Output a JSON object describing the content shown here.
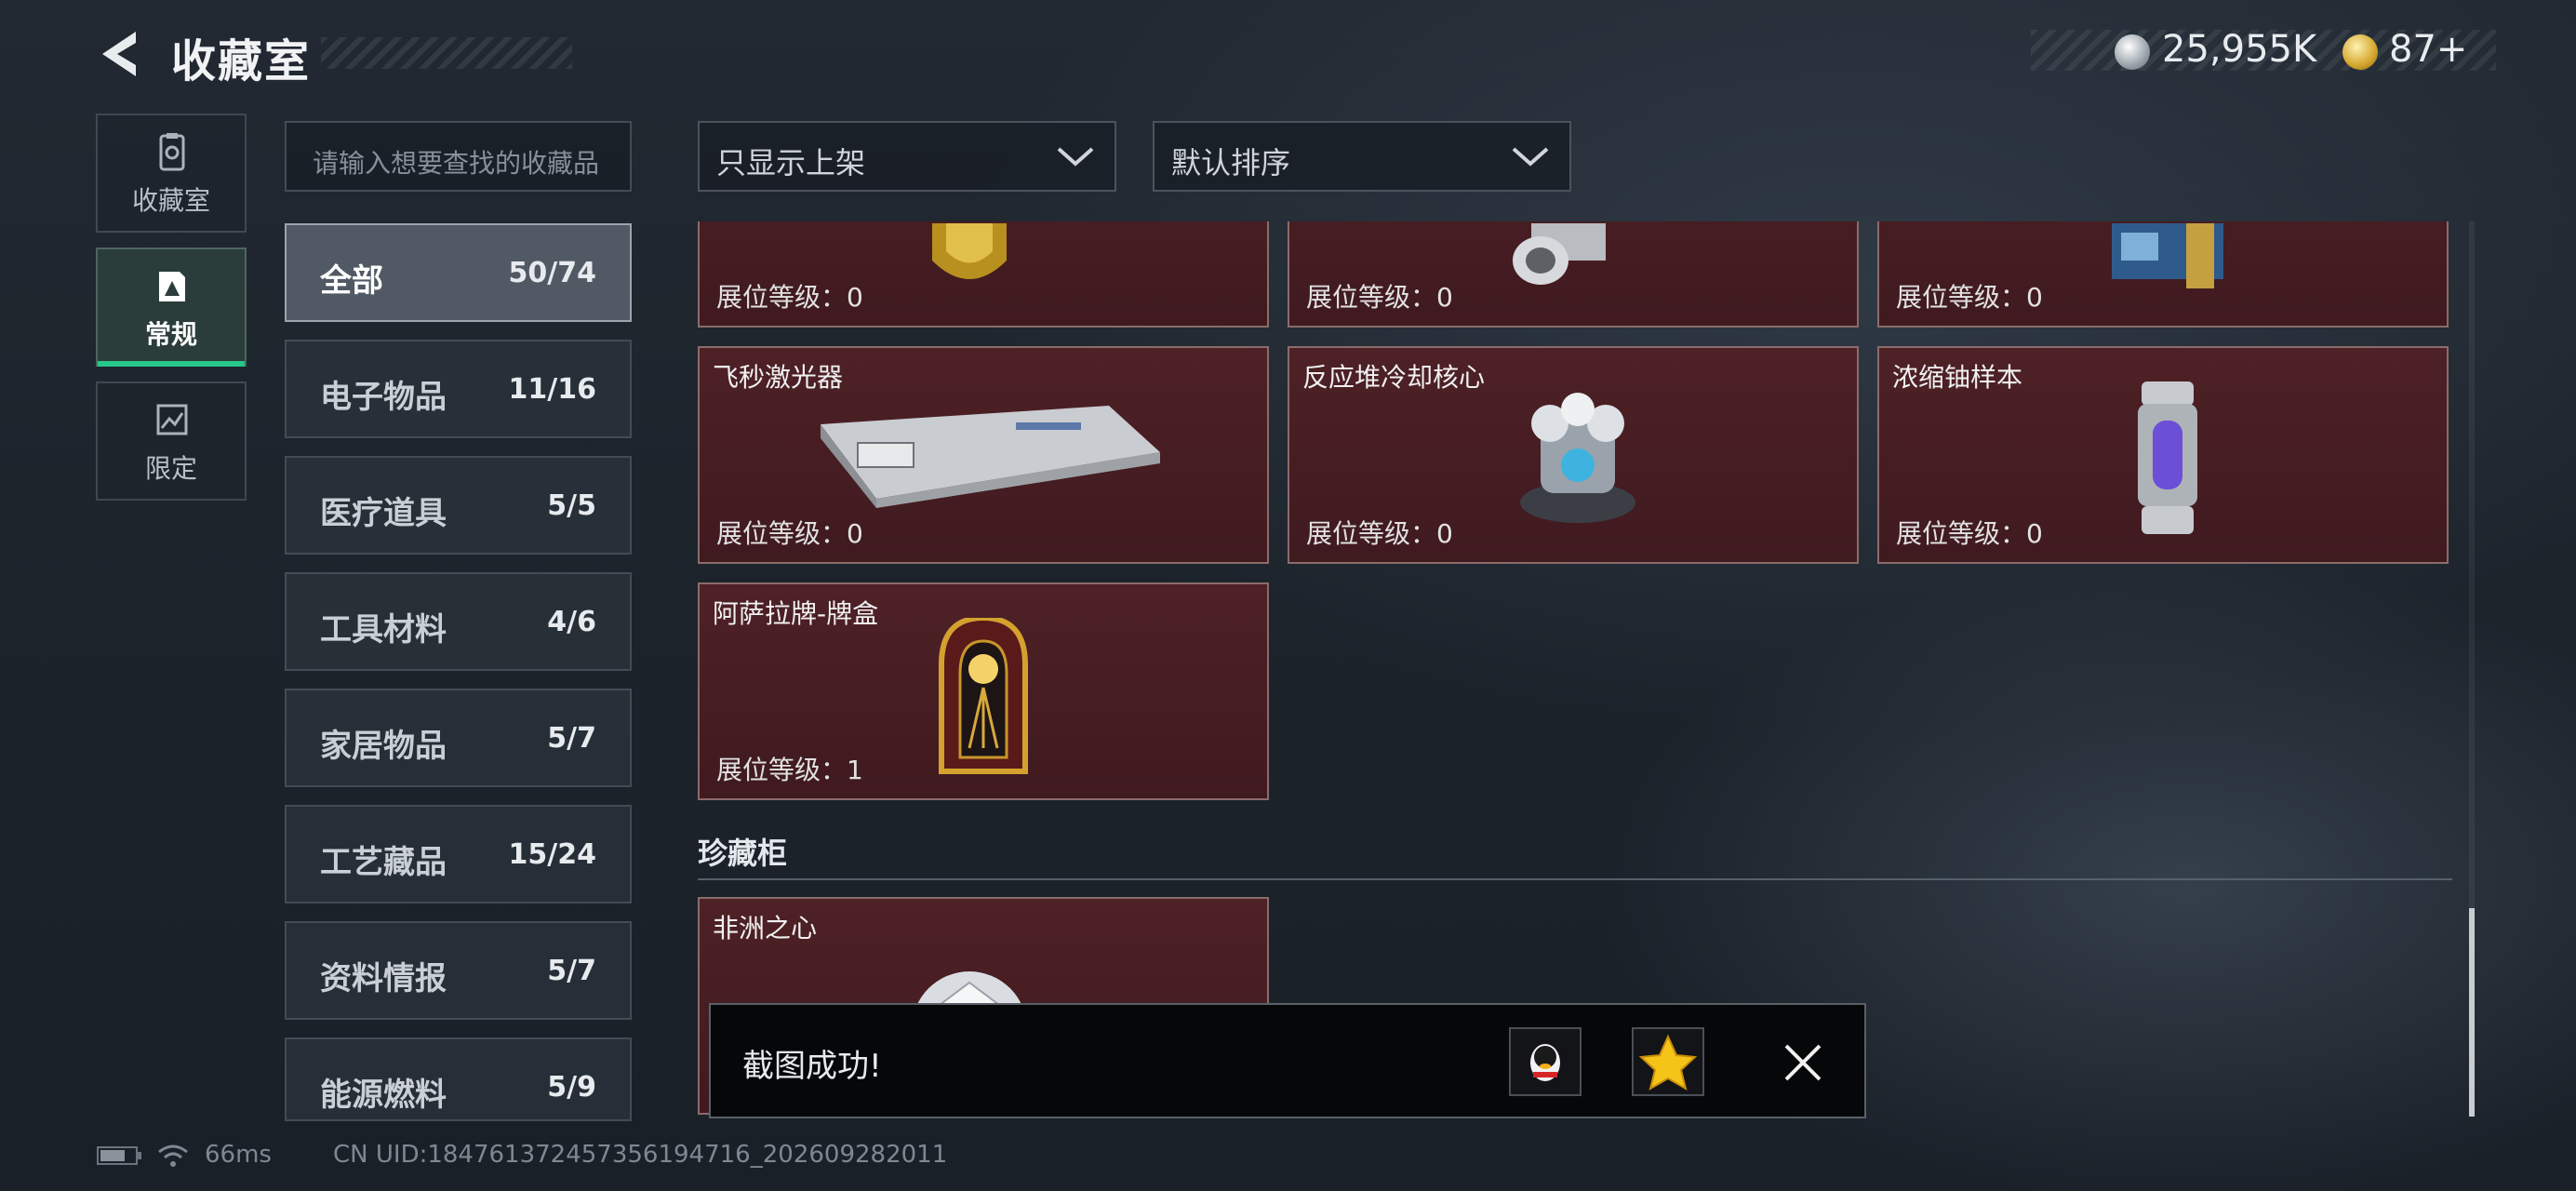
{
  "header": {
    "title": "收藏室"
  },
  "currency": {
    "silver": "25,955K",
    "gold": "87+"
  },
  "left_nav": [
    {
      "label": "收藏室",
      "icon": "collection-room-icon"
    },
    {
      "label": "常规",
      "icon": "regular-icon",
      "active": true
    },
    {
      "label": "限定",
      "icon": "limited-icon"
    }
  ],
  "search": {
    "placeholder": "请输入想要查找的收藏品"
  },
  "categories": [
    {
      "name": "全部",
      "count": "50/74",
      "active": true
    },
    {
      "name": "电子物品",
      "count": "11/16"
    },
    {
      "name": "医疗道具",
      "count": "5/5"
    },
    {
      "name": "工具材料",
      "count": "4/6"
    },
    {
      "name": "家居物品",
      "count": "5/7"
    },
    {
      "name": "工艺藏品",
      "count": "15/24"
    },
    {
      "name": "资料情报",
      "count": "5/7"
    },
    {
      "name": "能源燃料",
      "count": "5/9"
    }
  ],
  "filters": {
    "display": "只显示上架",
    "sort": "默认排序"
  },
  "items": [
    {
      "name": "",
      "level_label": "展位等级：",
      "level": "0"
    },
    {
      "name": "",
      "level_label": "展位等级：",
      "level": "0"
    },
    {
      "name": "",
      "level_label": "展位等级：",
      "level": "0"
    },
    {
      "name": "飞秒激光器",
      "level_label": "展位等级：",
      "level": "0"
    },
    {
      "name": "反应堆冷却核心",
      "level_label": "展位等级：",
      "level": "0"
    },
    {
      "name": "浓缩铀样本",
      "level_label": "展位等级：",
      "level": "0"
    },
    {
      "name": "阿萨拉牌-牌盒",
      "level_label": "展位等级：",
      "level": "1"
    }
  ],
  "treasure_section": {
    "title": "珍藏柜",
    "items": [
      {
        "name": "非洲之心"
      }
    ]
  },
  "toast": {
    "message": "截图成功!"
  },
  "status": {
    "ping": "66ms",
    "uid": "CN UID:184761372457356194716_202609282011"
  },
  "colors": {
    "accent_green": "#28c88a",
    "card_bg": "#4e2126",
    "card_border": "#8a6c6a"
  }
}
